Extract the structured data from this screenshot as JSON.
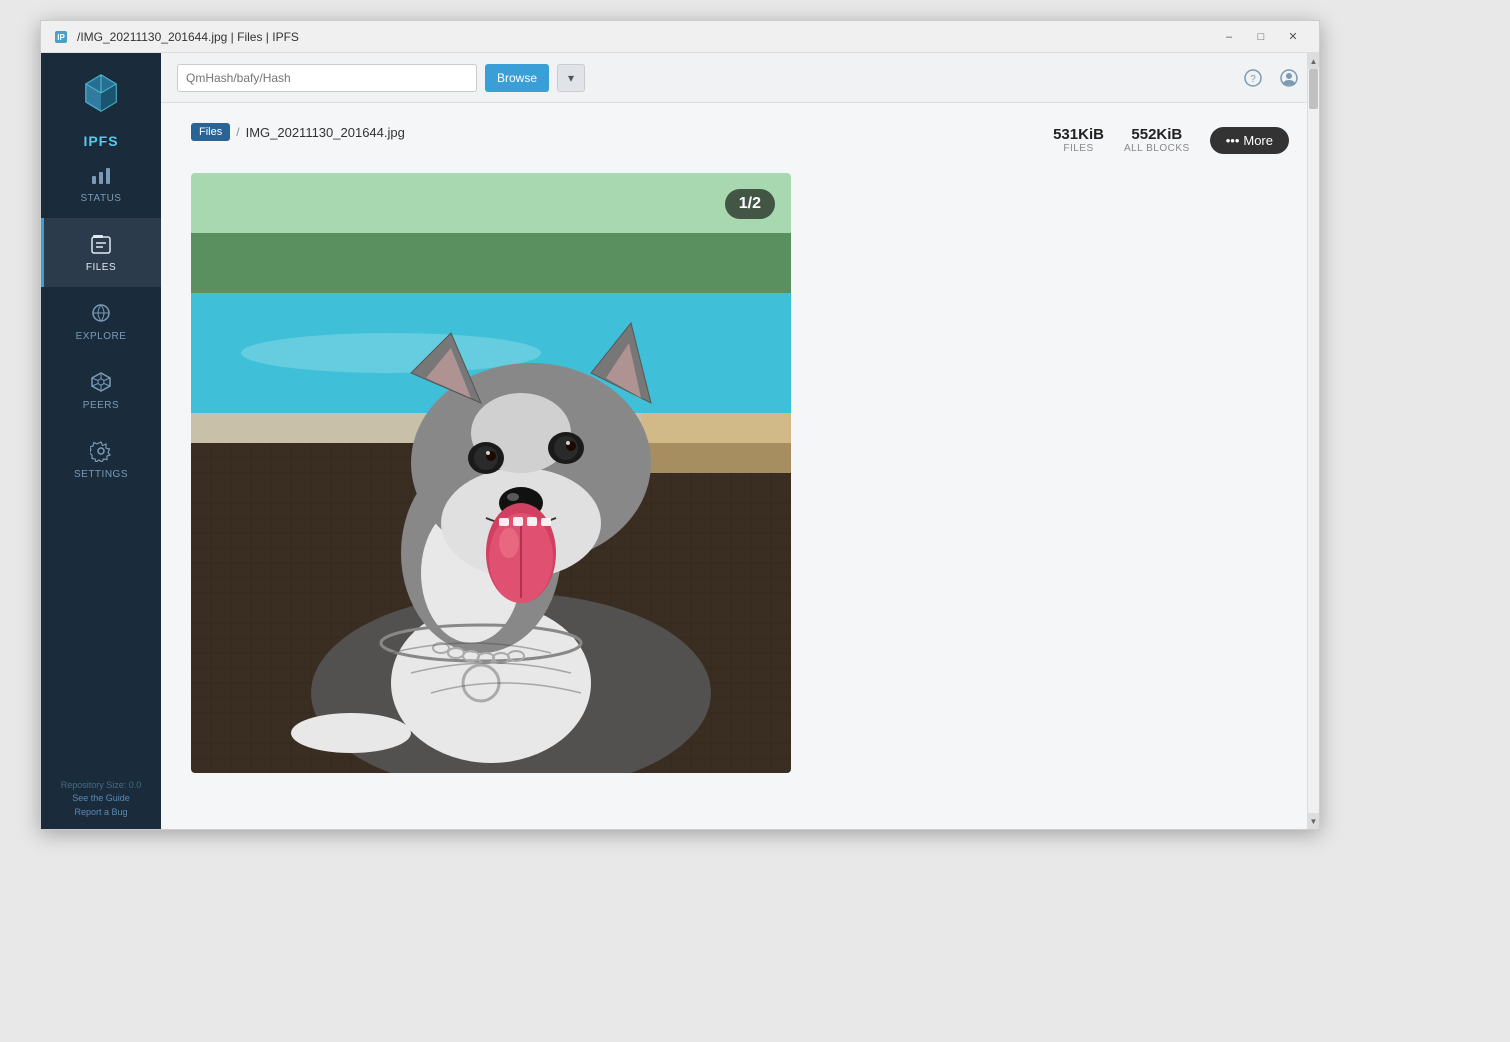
{
  "window": {
    "title": "/IMG_20211130_201644.jpg | Files | IPFS",
    "titlebar_icon": "ipfs-cube"
  },
  "titlebar": {
    "minimize_label": "–",
    "maximize_label": "□",
    "close_label": "✕"
  },
  "sidebar": {
    "app_name": "IPFS",
    "items": [
      {
        "id": "status",
        "label": "STATUS",
        "icon": "chart-icon"
      },
      {
        "id": "files",
        "label": "FILES",
        "icon": "file-icon",
        "active": true
      },
      {
        "id": "explore",
        "label": "EXPLORE",
        "icon": "explore-icon"
      },
      {
        "id": "peers",
        "label": "PEERS",
        "icon": "peers-icon"
      },
      {
        "id": "settings",
        "label": "SETTINGS",
        "icon": "settings-icon"
      }
    ],
    "footer": {
      "line1": "Repository Size: 0.0",
      "line2": "See the Guide",
      "line3": "Report a Bug"
    }
  },
  "topbar": {
    "search_placeholder": "QmHash/bafy/Hash",
    "browse_label": "Browse",
    "help_icon": "help-icon",
    "user_icon": "user-icon"
  },
  "breadcrumb": {
    "files_label": "Files",
    "separator": "/",
    "current_file": "IMG_20211130_201644.jpg"
  },
  "file_info": {
    "files_size": "531KiB",
    "files_label": "FILES",
    "all_blocks_size": "552KiB",
    "all_blocks_label": "ALL BLOCKS",
    "more_icon": "ellipsis-icon",
    "more_label": "More"
  },
  "image": {
    "counter": "1/2",
    "alt": "Dog photo - Husky/Corgi mix by a pool"
  }
}
